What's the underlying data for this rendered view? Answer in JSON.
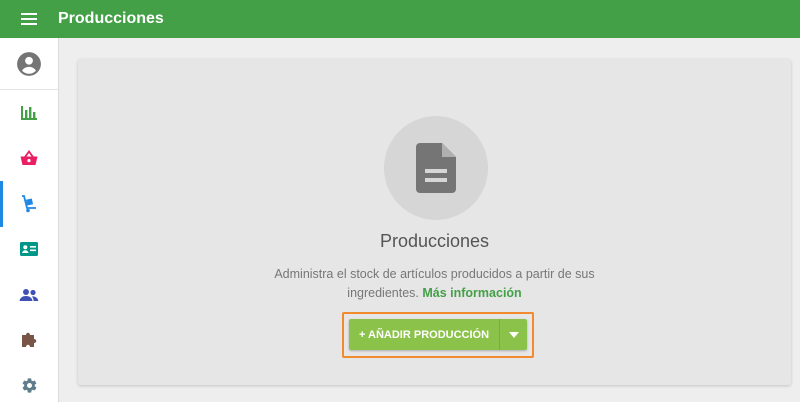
{
  "header": {
    "title": "Producciones",
    "menu_icon": "menu-icon",
    "background": "#43a047"
  },
  "sidebar": {
    "items": [
      {
        "name": "user-avatar",
        "icon": "account-circle-icon",
        "color": "#757575"
      },
      {
        "name": "reports",
        "icon": "bar-chart-icon",
        "color": "#43a047"
      },
      {
        "name": "sales",
        "icon": "basket-icon",
        "color": "#e91e63"
      },
      {
        "name": "productions",
        "icon": "hand-truck-icon",
        "color": "#1e88e5",
        "active": true
      },
      {
        "name": "contacts",
        "icon": "contact-card-icon",
        "color": "#009688"
      },
      {
        "name": "users",
        "icon": "people-icon",
        "color": "#3f51b5"
      },
      {
        "name": "integrations",
        "icon": "puzzle-icon",
        "color": "#795548"
      },
      {
        "name": "settings",
        "icon": "gear-icon",
        "color": "#607d8b"
      }
    ]
  },
  "empty_state": {
    "icon": "document-icon",
    "title": "Producciones",
    "description": "Administra el stock de artículos producidos a partir de sus ingredientes.",
    "link_text": "Más información",
    "link_color": "#43a047"
  },
  "actions": {
    "add_button_label": "+ AÑADIR PRODUCCIÓN",
    "dropdown_icon": "caret-down-icon",
    "button_color": "#8bc34a",
    "highlight_color": "#f28a2e"
  }
}
